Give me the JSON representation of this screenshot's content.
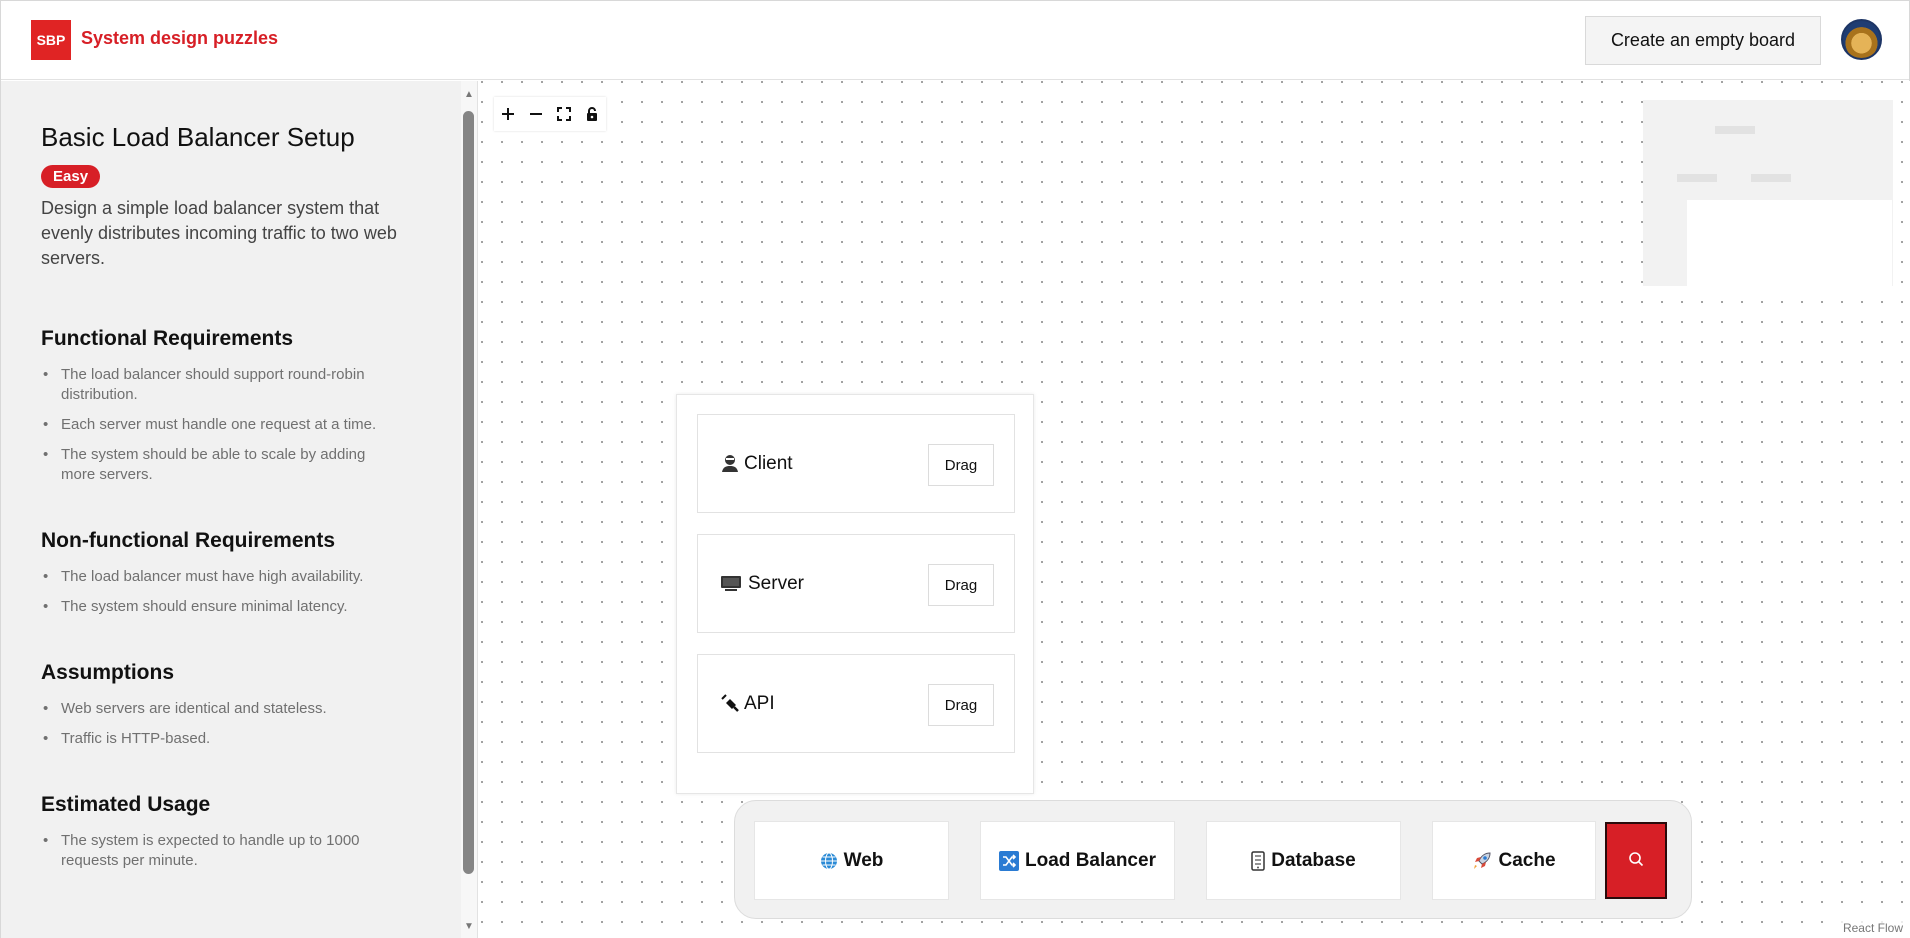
{
  "header": {
    "logo_text": "SBP",
    "app_title": "System design puzzles",
    "create_board_label": "Create an empty board"
  },
  "sidebar": {
    "title": "Basic Load Balancer Setup",
    "difficulty": "Easy",
    "description": "Design a simple load balancer system that evenly distributes incoming traffic to two web servers.",
    "sections": [
      {
        "title": "Functional Requirements",
        "items": [
          "The load balancer should support round-robin distribution.",
          "Each server must handle one request at a time.",
          "The system should be able to scale by adding more servers."
        ]
      },
      {
        "title": "Non-functional Requirements",
        "items": [
          "The load balancer must have high availability.",
          "The system should ensure minimal latency."
        ]
      },
      {
        "title": "Assumptions",
        "items": [
          "Web servers are identical and stateless.",
          "Traffic is HTTP-based."
        ]
      },
      {
        "title": "Estimated Usage",
        "items": [
          "The system is expected to handle up to 1000 requests per minute."
        ]
      }
    ]
  },
  "panel": {
    "components": [
      {
        "label": "Client",
        "icon": "person-icon",
        "drag_label": "Drag"
      },
      {
        "label": "Server",
        "icon": "monitor-icon",
        "drag_label": "Drag"
      },
      {
        "label": "API",
        "icon": "plug-icon",
        "drag_label": "Drag"
      }
    ]
  },
  "toolbar": {
    "categories": [
      {
        "label": "Web",
        "icon": "globe-icon"
      },
      {
        "label": "Load Balancer",
        "icon": "shuffle-icon"
      },
      {
        "label": "Database",
        "icon": "database-icon"
      },
      {
        "label": "Cache",
        "icon": "rocket-icon"
      }
    ],
    "search_icon": "search-icon"
  },
  "attribution": "React Flow",
  "colors": {
    "accent": "#d71f26",
    "sidebar_bg": "#f1f1f1",
    "toolbar_bg": "#f1f1f1"
  }
}
